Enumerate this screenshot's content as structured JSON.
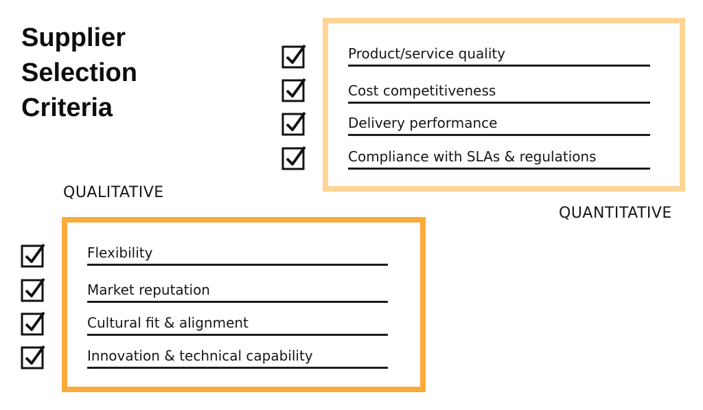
{
  "title": {
    "lines": [
      "Supplier",
      "Selection",
      "Criteria"
    ]
  },
  "colors": {
    "quantitative_border": "#fed594",
    "qualitative_border": "#f9ac3a",
    "text": "#151515"
  },
  "quantitative": {
    "label": "QUANTITATIVE",
    "items": [
      {
        "label": "Product/service quality",
        "checked": true
      },
      {
        "label": "Cost competitiveness",
        "checked": true
      },
      {
        "label": "Delivery performance",
        "checked": true
      },
      {
        "label": "Compliance with SLAs & regulations",
        "checked": true
      }
    ]
  },
  "qualitative": {
    "label": "QUALITATIVE",
    "items": [
      {
        "label": "Flexibility",
        "checked": true
      },
      {
        "label": "Market reputation",
        "checked": true
      },
      {
        "label": "Cultural fit & alignment",
        "checked": true
      },
      {
        "label": "Innovation & technical capability",
        "checked": true
      }
    ]
  },
  "icons": {
    "checkbox": "checked-checkbox-icon"
  }
}
